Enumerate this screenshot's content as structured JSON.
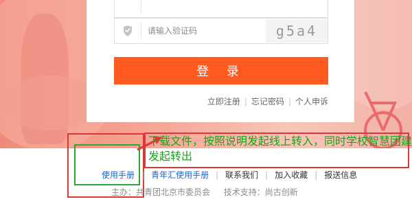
{
  "captcha_input": {
    "placeholder": "请输入验证码",
    "icon": "shield-icon"
  },
  "captcha_image": {
    "text": "g5a4"
  },
  "login_button": {
    "label": "登 录"
  },
  "links": {
    "register": "立即注册",
    "forgot": "忘记密码",
    "appeal": "个人申诉"
  },
  "annotation": {
    "text": "下载文件，按照说明发起线上转入，同时学校智慧团建发起转出"
  },
  "footer": {
    "manual": "使用手册",
    "youth_manual": "青年汇使用手册",
    "contact": "联系我们",
    "favorite": "加入收藏",
    "report": "报送信息",
    "host_label": "主办：",
    "host": "共青团北京市委员会",
    "tech_label": "技术支持：",
    "tech": "尚古创新"
  },
  "colors": {
    "accent": "#ff5a1f",
    "annotation_green": "#1aa31a",
    "link_blue": "#1a64c8",
    "annotation_red": "#e03535"
  }
}
